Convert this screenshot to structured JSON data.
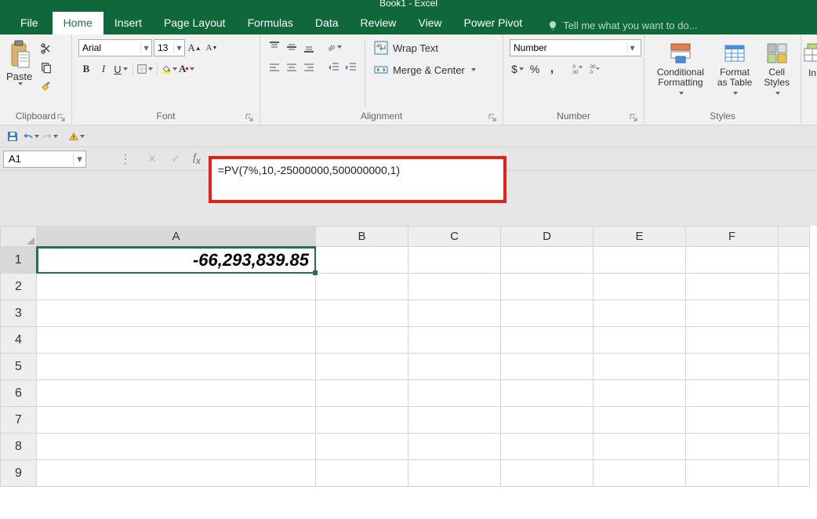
{
  "app": {
    "title": "Book1 - Excel"
  },
  "tabs": {
    "file": "File",
    "home": "Home",
    "insert": "Insert",
    "page_layout": "Page Layout",
    "formulas": "Formulas",
    "data": "Data",
    "review": "Review",
    "view": "View",
    "power_pivot": "Power Pivot",
    "tellme": "Tell me what you want to do..."
  },
  "ribbon": {
    "clipboard": {
      "paste": "Paste",
      "label": "Clipboard"
    },
    "font": {
      "name": "Arial",
      "size": "13",
      "bold": "B",
      "italic": "I",
      "underline": "U",
      "label": "Font"
    },
    "alignment": {
      "wrap": "Wrap Text",
      "merge": "Merge & Center",
      "label": "Alignment"
    },
    "number": {
      "format": "Number",
      "label": "Number"
    },
    "styles": {
      "cond": "Conditional Formatting",
      "table": "Format as Table",
      "cell": "Cell Styles",
      "label": "Styles"
    },
    "insert_label": "In"
  },
  "formula_bar": {
    "cell_ref": "A1",
    "formula": "=PV(7%,10,-25000000,500000000,1)"
  },
  "grid": {
    "columns": [
      "A",
      "B",
      "C",
      "D",
      "E",
      "F"
    ],
    "rows": [
      "1",
      "2",
      "3",
      "4",
      "5",
      "6",
      "7",
      "8",
      "9"
    ],
    "a1_value": "-66,293,839.85"
  }
}
